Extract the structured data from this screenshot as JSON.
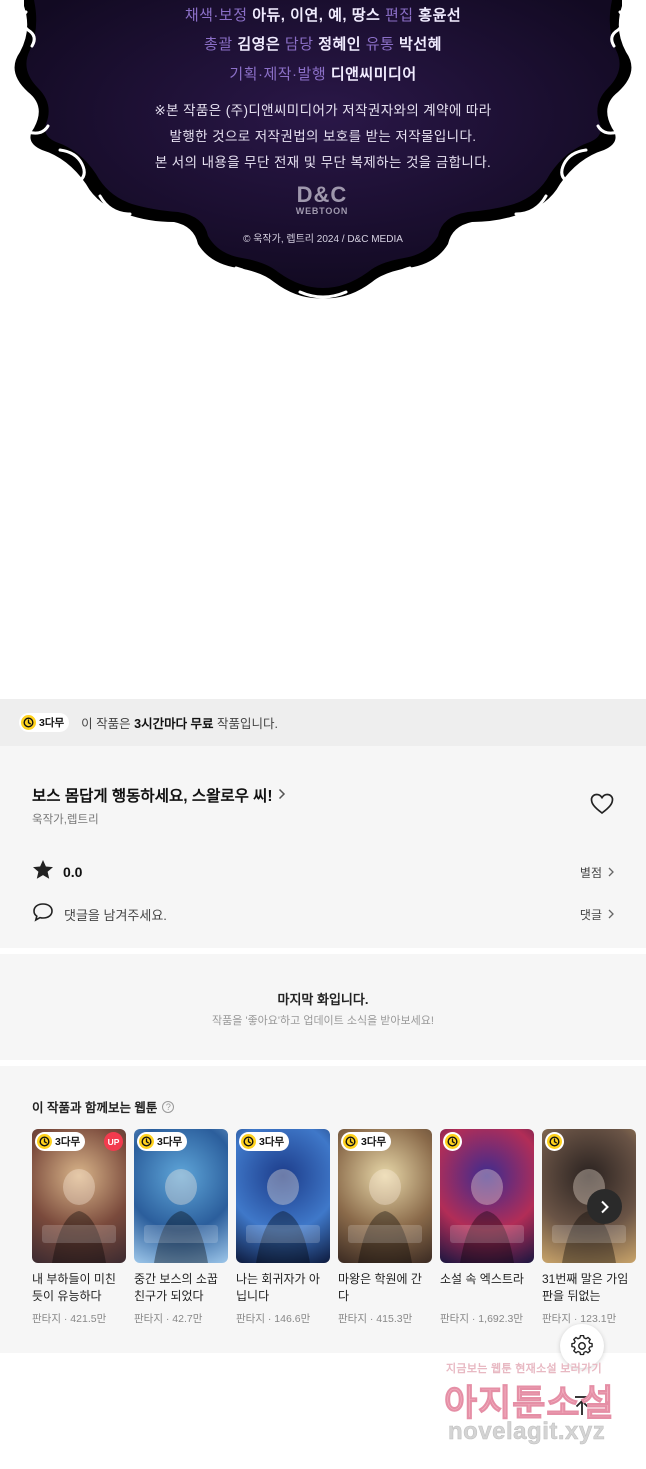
{
  "credits": {
    "line1": {
      "role1": "채색·보정",
      "names": "아듀, 이연, 예, 땅스",
      "role2": "편집",
      "name2": "홍윤선"
    },
    "line2": {
      "role1": "총괄",
      "name1": "김영은",
      "role2": "담당",
      "name2": "정혜인",
      "role3": "유통",
      "name3": "박선혜"
    },
    "line3": {
      "role1": "기획·제작·발행",
      "name1": "디앤씨미디어"
    },
    "notice": [
      "※본 작품은 (주)디앤씨미디어가 저작권자와의 계약에 따라",
      "발행한 것으로 저작권법의 보호를 받는 저작물입니다.",
      "본 서의 내용을 무단 전재 및 무단 복제하는 것을 금합니다."
    ],
    "logo_big": "D&C",
    "logo_small": "WEBTOON",
    "copyright": "© 욱작가, 렙트리 2024 / D&C MEDIA"
  },
  "free_banner": {
    "badge": "3다무",
    "text_prefix": "이 작품은 ",
    "text_bold": "3시간마다 무료",
    "text_suffix": " 작품입니다."
  },
  "work": {
    "title": "보스 몸답게 행동하세요, 스왈로우 씨!",
    "authors": "욱작가,렙트리",
    "rating": "0.0",
    "rating_link": "별점",
    "comment_placeholder": "댓글을 남겨주세요.",
    "comment_link": "댓글"
  },
  "last_episode": {
    "title": "마지막 화입니다.",
    "subtitle": "작품을 '좋아요'하고 업데이트 소식을 받아보세요!"
  },
  "recommendations": {
    "heading": "이 작품과 함께보는 웹툰",
    "help": "?",
    "items": [
      {
        "badge": "3다무",
        "up": "UP",
        "title": "내 부하들이 미친 듯이 유능하다",
        "meta": "판타지 · 421.5만",
        "colors": [
          "#d9b58a",
          "#7a4a3c",
          "#3b2a30"
        ]
      },
      {
        "badge": "3다무",
        "up": "",
        "title": "중간 보스의 소꿉친구가 되었다",
        "meta": "판타지 · 42.7만",
        "colors": [
          "#5fa6d9",
          "#2b5e9c",
          "#9ec7ea"
        ]
      },
      {
        "badge": "3다무",
        "up": "",
        "title": "나는 회귀자가 아닙니다",
        "meta": "판타지 · 146.6만",
        "colors": [
          "#1d3c8a",
          "#3f78c9",
          "#0d1a3d"
        ]
      },
      {
        "badge": "3다무",
        "up": "",
        "title": "마왕은 학원에 간다",
        "meta": "판타지 · 415.3만",
        "colors": [
          "#e7d7a8",
          "#8a6a4a",
          "#3a2a22"
        ]
      },
      {
        "badge": "",
        "up": "",
        "title": "소설 속 엑스트라",
        "meta": "판타지 · 1,692.3만",
        "colors": [
          "#3d2c8f",
          "#b22d57",
          "#1a1640"
        ]
      },
      {
        "badge": "",
        "up": "",
        "title": "31번째 말은 가임판을 뒤없는",
        "meta": "판타지 · 123.1만",
        "colors": [
          "#2a2220",
          "#6a5446",
          "#c9a46a"
        ]
      }
    ]
  },
  "watermark": {
    "small": "지금보는 웹툰 현재소설 보러가기",
    "big": "아지툰소설",
    "url": "novelagit.xyz"
  }
}
